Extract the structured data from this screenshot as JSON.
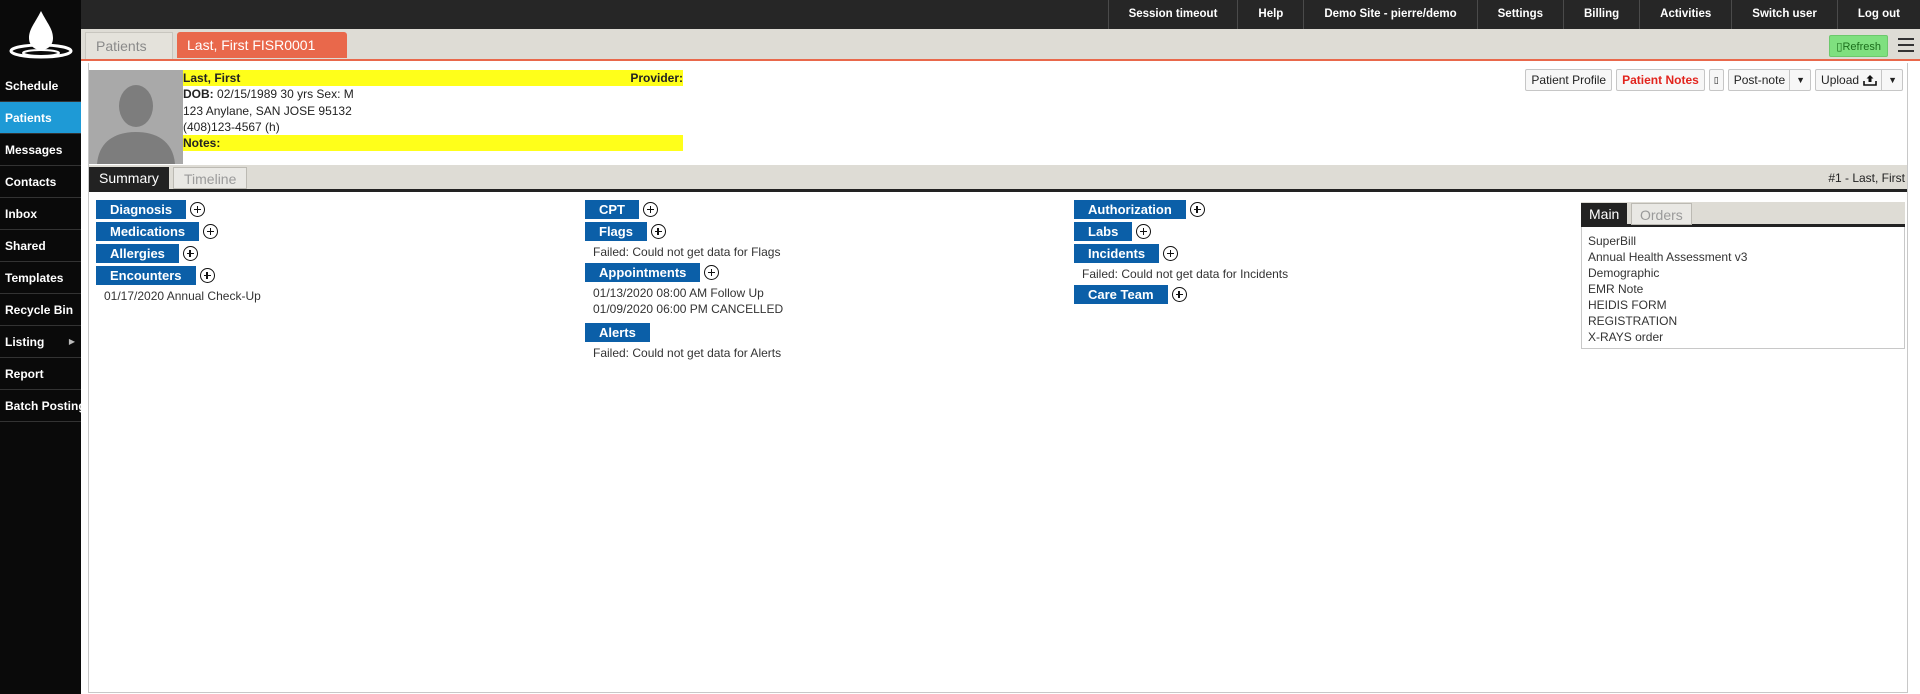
{
  "sidebar": {
    "items": [
      {
        "label": "Schedule"
      },
      {
        "label": "Patients"
      },
      {
        "label": "Messages"
      },
      {
        "label": "Contacts"
      },
      {
        "label": "Inbox"
      },
      {
        "label": "Shared"
      },
      {
        "label": "Templates"
      },
      {
        "label": "Recycle Bin"
      },
      {
        "label": "Listing"
      },
      {
        "label": "Report"
      },
      {
        "label": "Batch Posting"
      }
    ],
    "active_color": "#1e9ad6"
  },
  "topbar": {
    "items": [
      "Session timeout",
      "Help",
      "Demo Site - pierre/demo",
      "Settings",
      "Billing",
      "Activities",
      "Switch user",
      "Log out"
    ]
  },
  "tabs": {
    "patients": "Patients",
    "chart": "Last, First FISR0001",
    "refresh": "▯Refresh",
    "accent_color": "#e9684b"
  },
  "patient": {
    "name": "Last, First",
    "provider_label": "Provider:",
    "dob_label": "DOB:",
    "dob": "02/15/1989 30 yrs Sex: M",
    "address": "123 Anylane, SAN JOSE 95132",
    "phone": "(408)123-4567 (h)",
    "notes_label": "Notes:"
  },
  "actions": {
    "profile": "Patient Profile",
    "notes": "Patient Notes",
    "small": "▯",
    "postnote": "Post-note",
    "upload": "Upload"
  },
  "subtabs": {
    "summary": "Summary",
    "timeline": "Timeline",
    "chart_id": "#1 - Last, First"
  },
  "columns": {
    "col1": {
      "diagnosis": "Diagnosis",
      "medications": "Medications",
      "allergies": "Allergies",
      "encounters": "Encounters",
      "encounter_entries": [
        "01/17/2020 Annual Check-Up"
      ]
    },
    "col2": {
      "cpt": "CPT",
      "flags": "Flags",
      "flags_msg": "Failed: Could not get data for Flags",
      "appointments": "Appointments",
      "appointment_entries": [
        "01/13/2020 08:00 AM Follow Up",
        "01/09/2020 06:00 PM CANCELLED"
      ],
      "alerts": "Alerts",
      "alerts_msg": "Failed: Could not get data for Alerts"
    },
    "col3": {
      "authorization": "Authorization",
      "labs": "Labs",
      "incidents": "Incidents",
      "incidents_msg": "Failed: Could not get data for Incidents",
      "careteam": "Care Team"
    }
  },
  "rightpanel": {
    "main_tab": "Main",
    "orders_tab": "Orders",
    "forms": [
      "SuperBill",
      "Annual Health Assessment v3",
      "Demographic",
      "EMR Note",
      "HEIDIS FORM",
      "REGISTRATION",
      "X-RAYS order"
    ]
  },
  "colors": {
    "section_blue": "#0b5fa8",
    "highlight_yellow": "#ffff1a",
    "refresh_green": "#7fe07f"
  }
}
